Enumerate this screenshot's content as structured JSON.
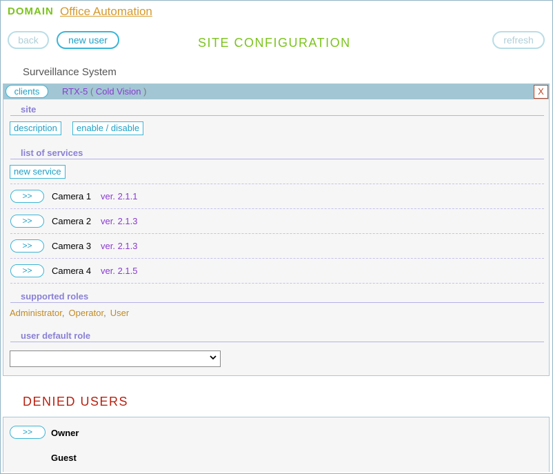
{
  "header": {
    "domain_label": "DOMAIN",
    "domain_name": "Office Automation",
    "page_title": "SITE CONFIGURATION"
  },
  "toolbar": {
    "back_label": "back",
    "new_user_label": "new user",
    "refresh_label": "refresh"
  },
  "system_name": "Surveillance System",
  "panel": {
    "clients_label": "clients",
    "device_model": "RTX-5",
    "device_open_paren": "(",
    "device_brand": "Cold Vision",
    "device_close_paren": ")",
    "close_label": "X",
    "site_heading": "site",
    "description_label": "description",
    "enable_disable_label": "enable / disable",
    "services_heading": "list of services",
    "new_service_label": "new service",
    "services": [
      {
        "arrow": ">>",
        "name": "Camera 1",
        "version": "ver. 2.1.1"
      },
      {
        "arrow": ">>",
        "name": "Camera 2",
        "version": "ver. 2.1.3"
      },
      {
        "arrow": ">>",
        "name": "Camera 3",
        "version": "ver. 2.1.3"
      },
      {
        "arrow": ">>",
        "name": "Camera 4",
        "version": "ver. 2.1.5"
      }
    ],
    "roles_heading": "supported roles",
    "roles": [
      "Administrator",
      "Operator",
      "User"
    ],
    "role_separator": ",",
    "default_role_heading": "user default role",
    "default_role_value": ""
  },
  "denied": {
    "title": "DENIED USERS",
    "arrow": ">>",
    "users": [
      "Owner",
      "Guest"
    ]
  },
  "colors": {
    "accent_green": "#7cc41c",
    "link_orange": "#d49a2c",
    "button_blue": "#1fa0c6",
    "header_bar": "#a2c6d4",
    "version_purple": "#8a3ad0",
    "section_heading": "#8a80d6",
    "denied_red": "#b82010"
  },
  "icons": {
    "close": "close-icon",
    "dropdown": "chevron-down-icon"
  }
}
